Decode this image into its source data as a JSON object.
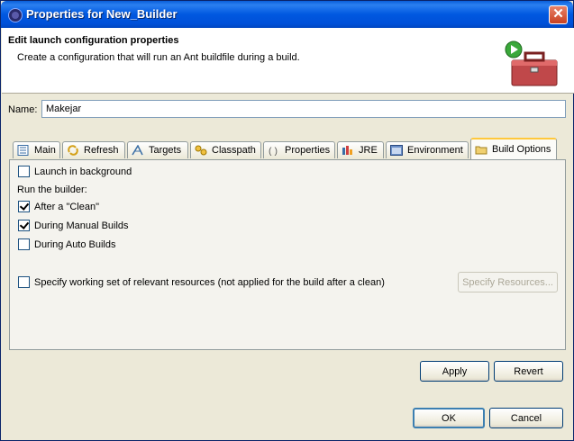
{
  "window": {
    "title": "Properties for New_Builder"
  },
  "banner": {
    "title": "Edit launch configuration properties",
    "description": "Create a configuration that will run an Ant buildfile during a build."
  },
  "name_field": {
    "label": "Name:",
    "value": "Makejar"
  },
  "tabs": [
    {
      "label": "Main",
      "icon": "main-icon"
    },
    {
      "label": "Refresh",
      "icon": "refresh-icon"
    },
    {
      "label": "Targets",
      "icon": "targets-icon"
    },
    {
      "label": "Classpath",
      "icon": "classpath-icon"
    },
    {
      "label": "Properties",
      "icon": "properties-icon"
    },
    {
      "label": "JRE",
      "icon": "jre-icon"
    },
    {
      "label": "Environment",
      "icon": "environment-icon"
    },
    {
      "label": "Build Options",
      "icon": "build-options-icon",
      "active": true
    }
  ],
  "build_options": {
    "launch_background": {
      "label": "Launch in background",
      "checked": false
    },
    "run_builder_label": "Run the builder:",
    "after_clean": {
      "label": "After a \"Clean\"",
      "checked": true
    },
    "manual_builds": {
      "label": "During Manual Builds",
      "checked": true
    },
    "auto_builds": {
      "label": "During Auto Builds",
      "checked": false
    },
    "working_set": {
      "label": "Specify working set of relevant resources (not applied for the build after a clean)",
      "checked": false
    },
    "specify_resources_label": "Specify Resources..."
  },
  "buttons": {
    "apply": "Apply",
    "revert": "Revert",
    "ok": "OK",
    "cancel": "Cancel"
  }
}
